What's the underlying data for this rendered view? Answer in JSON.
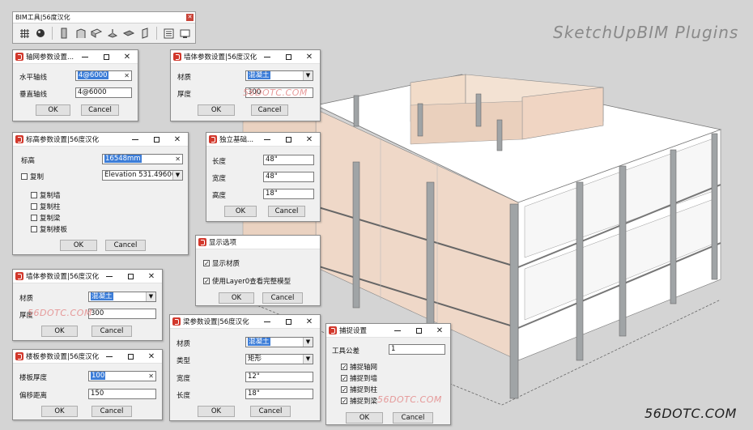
{
  "branding": {
    "plugin_title": "SketchUpBIM  Plugins",
    "site": "56DOTC.COM",
    "watermark": "56DOTC.COM"
  },
  "colors": {
    "accent_selection": "#3c7dd8",
    "sketchup_logo": "#d2382c",
    "wall_fill": "#efd8c8",
    "column": "#a0a4a6",
    "slab": "#ffffff"
  },
  "toolbar": {
    "title": "BIM工具|56度汉化",
    "icons": [
      "grid-icon",
      "ball-icon",
      "column-icon",
      "wall-icon",
      "beam-icon",
      "foundation-icon",
      "slab-icon",
      "door-icon",
      "list-icon",
      "display-icon"
    ]
  },
  "grid_dialog": {
    "title": "轴网参数设置...",
    "h_label": "水平轴线",
    "h_value": "4@6000",
    "v_label": "垂直轴线",
    "v_value": "4@6000",
    "ok": "OK",
    "cancel": "Cancel"
  },
  "wall_dialog_1": {
    "title": "墙体参数设置|56度汉化",
    "material_label": "材质",
    "material_value": "混凝土",
    "thickness_label": "厚度",
    "thickness_value": "300",
    "ok": "OK",
    "cancel": "Cancel"
  },
  "level_dialog": {
    "title": "标高参数设置|56度汉化",
    "level_label": "标高",
    "level_value": "16548mm",
    "copy_label": "复制",
    "copy_value": "Elevation 531.49606299...",
    "options": [
      "复制墙",
      "复制柱",
      "复制梁",
      "复制楼板"
    ],
    "ok": "OK",
    "cancel": "Cancel"
  },
  "footing_dialog": {
    "title": "独立基础...",
    "length_label": "长度",
    "length_value": "48\"",
    "width_label": "宽度",
    "width_value": "48\"",
    "height_label": "高度",
    "height_value": "18\"",
    "ok": "OK",
    "cancel": "Cancel"
  },
  "display_dialog": {
    "title": "显示选项",
    "opt1": "显示材质",
    "opt2": "使用Layer0查看完整模型",
    "ok": "OK",
    "cancel": "Cancel"
  },
  "wall_dialog_2": {
    "title": "墙体参数设置|56度汉化",
    "material_label": "材质",
    "material_value": "混凝土",
    "thickness_label": "厚度",
    "thickness_value": "300",
    "ok": "OK",
    "cancel": "Cancel"
  },
  "slab_dialog": {
    "title": "楼板参数设置|56度汉化",
    "thickness_label": "楼板厚度",
    "thickness_value": "100",
    "offset_label": "偏移距离",
    "offset_value": "150",
    "ok": "OK",
    "cancel": "Cancel"
  },
  "beam_dialog": {
    "title": "梁参数设置|56度汉化",
    "material_label": "材质",
    "material_value": "混凝土",
    "type_label": "类型",
    "type_value": "矩形",
    "width_label": "宽度",
    "width_value": "12\"",
    "length_label": "长度",
    "length_value": "18\"",
    "ok": "OK",
    "cancel": "Cancel"
  },
  "snap_dialog": {
    "title": "捕捉设置",
    "tol_label": "工具公差",
    "tol_value": "1",
    "options": [
      "捕捉轴网",
      "捕捉到墙",
      "捕捉到柱",
      "捕捉到梁"
    ],
    "ok": "OK",
    "cancel": "Cancel"
  }
}
